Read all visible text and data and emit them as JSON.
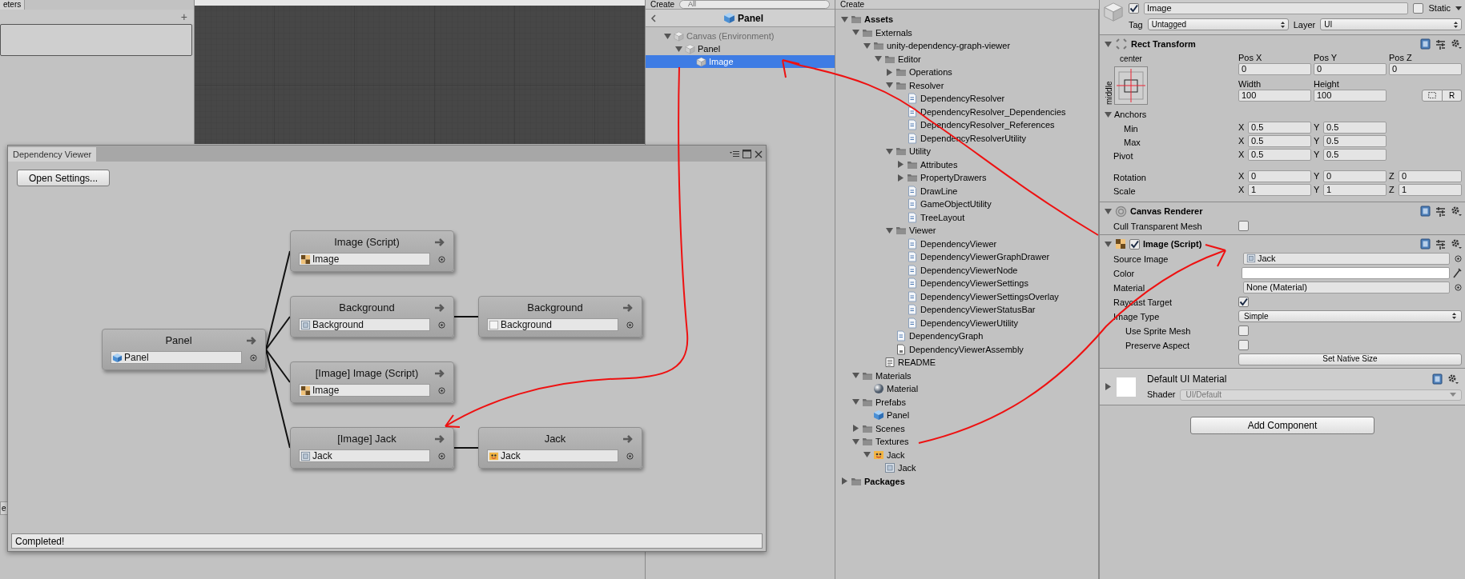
{
  "left_panel": {
    "tab": "eters",
    "add_button": "+"
  },
  "bottom_left_tab": "e",
  "hierarchy": {
    "create_button": "Create",
    "search_placeholder": "All",
    "breadcrumb": "Panel",
    "items": [
      {
        "label": "Canvas (Environment)",
        "dimmed": true,
        "selected": false,
        "expanded": true,
        "children": [
          {
            "label": "Panel",
            "dimmed": false,
            "selected": false,
            "expanded": true,
            "children": [
              {
                "label": "Image",
                "dimmed": false,
                "selected": true
              }
            ]
          }
        ]
      }
    ]
  },
  "dependency_viewer": {
    "title": "Dependency Viewer",
    "settings_button": "Open Settings...",
    "status": "Completed!",
    "graph": {
      "title": "Panel",
      "field": "Panel",
      "kind": "prefab",
      "children": [
        {
          "title": "Image (Script)",
          "field": "Image",
          "kind": "script"
        },
        {
          "title": "Background",
          "field": "Background",
          "kind": "sprite",
          "children": [
            {
              "title": "Background",
              "field": "Background",
              "kind": "blank"
            }
          ]
        },
        {
          "title": "[Image] Image (Script)",
          "field": "Image",
          "kind": "script"
        },
        {
          "title": "[Image] Jack",
          "field": "Jack",
          "kind": "sprite",
          "children": [
            {
              "title": "Jack",
              "field": "Jack",
              "kind": "texture"
            }
          ]
        }
      ]
    }
  },
  "project": {
    "create_button": "Create",
    "tree": [
      {
        "label": "Assets",
        "kind": "root",
        "expanded": true,
        "children": [
          {
            "label": "Externals",
            "kind": "folder",
            "expanded": true,
            "children": [
              {
                "label": "unity-dependency-graph-viewer",
                "kind": "folder",
                "expanded": true,
                "children": [
                  {
                    "label": "Editor",
                    "kind": "folder",
                    "expanded": true,
                    "children": [
                      {
                        "label": "Operations",
                        "kind": "folder",
                        "expanded": false
                      },
                      {
                        "label": "Resolver",
                        "kind": "folder",
                        "expanded": true,
                        "children": [
                          {
                            "label": "DependencyResolver",
                            "kind": "script"
                          },
                          {
                            "label": "DependencyResolver_Dependencies",
                            "kind": "script"
                          },
                          {
                            "label": "DependencyResolver_References",
                            "kind": "script"
                          },
                          {
                            "label": "DependencyResolverUtility",
                            "kind": "script"
                          }
                        ]
                      },
                      {
                        "label": "Utility",
                        "kind": "folder",
                        "expanded": true,
                        "children": [
                          {
                            "label": "Attributes",
                            "kind": "folder",
                            "expanded": false
                          },
                          {
                            "label": "PropertyDrawers",
                            "kind": "folder",
                            "expanded": false
                          },
                          {
                            "label": "DrawLine",
                            "kind": "script"
                          },
                          {
                            "label": "GameObjectUtility",
                            "kind": "script"
                          },
                          {
                            "label": "TreeLayout",
                            "kind": "script"
                          }
                        ]
                      },
                      {
                        "label": "Viewer",
                        "kind": "folder",
                        "expanded": true,
                        "children": [
                          {
                            "label": "DependencyViewer",
                            "kind": "script"
                          },
                          {
                            "label": "DependencyViewerGraphDrawer",
                            "kind": "script"
                          },
                          {
                            "label": "DependencyViewerNode",
                            "kind": "script"
                          },
                          {
                            "label": "DependencyViewerSettings",
                            "kind": "script"
                          },
                          {
                            "label": "DependencyViewerSettingsOverlay",
                            "kind": "script"
                          },
                          {
                            "label": "DependencyViewerStatusBar",
                            "kind": "script"
                          },
                          {
                            "label": "DependencyViewerUtility",
                            "kind": "script"
                          }
                        ]
                      },
                      {
                        "label": "DependencyGraph",
                        "kind": "script"
                      },
                      {
                        "label": "DependencyViewerAssembly",
                        "kind": "asset"
                      }
                    ]
                  },
                  {
                    "label": "README",
                    "kind": "text"
                  }
                ]
              }
            ]
          },
          {
            "label": "Materials",
            "kind": "folder",
            "expanded": true,
            "children": [
              {
                "label": "Material",
                "kind": "material"
              }
            ]
          },
          {
            "label": "Prefabs",
            "kind": "folder",
            "expanded": true,
            "children": [
              {
                "label": "Panel",
                "kind": "prefab"
              }
            ]
          },
          {
            "label": "Scenes",
            "kind": "folder",
            "expanded": false
          },
          {
            "label": "Textures",
            "kind": "folder",
            "expanded": true,
            "children": [
              {
                "label": "Jack",
                "kind": "texture",
                "expanded": true,
                "children": [
                  {
                    "label": "Jack",
                    "kind": "sprite"
                  }
                ]
              }
            ]
          }
        ]
      },
      {
        "label": "Packages",
        "kind": "root",
        "expanded": false
      }
    ]
  },
  "inspector": {
    "active": true,
    "name": "Image",
    "static": false,
    "static_label": "Static",
    "tag_label": "Tag",
    "tag": "Untagged",
    "layer_label": "Layer",
    "layer": "UI",
    "rect_transform": {
      "title": "Rect Transform",
      "expanded": true,
      "anchor_h": "center",
      "anchor_v": "middle",
      "position_fields": [
        {
          "label": "Pos X",
          "value": "0"
        },
        {
          "label": "Pos Y",
          "value": "0"
        },
        {
          "label": "Pos Z",
          "value": "0"
        }
      ],
      "size_fields": [
        {
          "label": "Width",
          "value": "100"
        },
        {
          "label": "Height",
          "value": "100"
        }
      ],
      "raw_button": "R",
      "anchors": {
        "label": "Anchors",
        "expanded": true,
        "rows": [
          {
            "label": "Min",
            "axes": [
              {
                "axis": "X",
                "value": "0.5"
              },
              {
                "axis": "Y",
                "value": "0.5"
              }
            ]
          },
          {
            "label": "Max",
            "axes": [
              {
                "axis": "X",
                "value": "0.5"
              },
              {
                "axis": "Y",
                "value": "0.5"
              }
            ]
          }
        ]
      },
      "pivot": {
        "label": "Pivot",
        "axes": [
          {
            "axis": "X",
            "value": "0.5"
          },
          {
            "axis": "Y",
            "value": "0.5"
          }
        ]
      },
      "transform_rows": [
        {
          "label": "Rotation",
          "axes": [
            {
              "axis": "X",
              "value": "0"
            },
            {
              "axis": "Y",
              "value": "0"
            },
            {
              "axis": "Z",
              "value": "0"
            }
          ]
        },
        {
          "label": "Scale",
          "axes": [
            {
              "axis": "X",
              "value": "1"
            },
            {
              "axis": "Y",
              "value": "1"
            },
            {
              "axis": "Z",
              "value": "1"
            }
          ]
        }
      ]
    },
    "canvas_renderer": {
      "title": "Canvas Renderer",
      "expanded": true,
      "properties": [
        {
          "kind": "checkbox",
          "label": "Cull Transparent Mesh",
          "checked": false
        }
      ]
    },
    "image": {
      "title": "Image (Script)",
      "enabled": true,
      "expanded": true,
      "properties": [
        {
          "kind": "object",
          "label": "Source Image",
          "value": "Jack"
        },
        {
          "kind": "color",
          "label": "Color",
          "color": "#ffffff"
        },
        {
          "kind": "object",
          "label": "Material",
          "value": "None (Material)"
        },
        {
          "kind": "checkbox",
          "label": "Raycast Target",
          "checked": true
        },
        {
          "kind": "dropdown",
          "label": "Image Type",
          "value": "Simple",
          "children": [
            {
              "kind": "checkbox",
              "label": "Use Sprite Mesh",
              "checked": false
            },
            {
              "kind": "checkbox",
              "label": "Preserve Aspect",
              "checked": false
            }
          ]
        },
        {
          "kind": "button",
          "label": "Set Native Size"
        }
      ]
    },
    "material": {
      "name": "Default UI Material",
      "shader_label": "Shader",
      "shader": "UI/Default",
      "expanded": false
    },
    "add_component": "Add Component"
  }
}
